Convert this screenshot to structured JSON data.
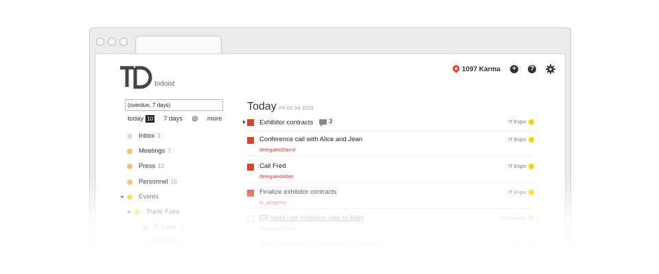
{
  "header": {
    "brand": "todoist",
    "karma": "1097 Karma",
    "add_icon": "+",
    "help_icon": "?"
  },
  "sidebar": {
    "filter_value": "(overdue, 7 days)",
    "quick": {
      "today": "today",
      "today_count": "10",
      "seven_days": "7 days",
      "at": "@",
      "more": "more"
    },
    "projects": [
      {
        "name": "Inbox",
        "count": "3",
        "color": "#dddddd"
      },
      {
        "name": "Meetings",
        "count": "7",
        "color": "#f5c36e"
      },
      {
        "name": "Press",
        "count": "12",
        "color": "#f5c36e"
      },
      {
        "name": "Personnel",
        "count": "10",
        "color": "#f5c36e"
      },
      {
        "name": "Events",
        "count": "",
        "color": "#f6d200"
      },
      {
        "name": "Trade Fairs",
        "count": "",
        "color": "#f6d200"
      },
      {
        "name": "IT Expo",
        "count": "10",
        "color": "#f6d200"
      },
      {
        "name": "CEBIT",
        "count": "14",
        "color": "#f6d200"
      }
    ]
  },
  "main": {
    "title": "Today",
    "date": "Fri 19 Jul 2013",
    "tasks": [
      {
        "title": "Exhibitor contracts",
        "sub": "",
        "project": "IT Expo",
        "comments": "3",
        "color": "#f6d200"
      },
      {
        "title": "Conference call with Alice and Jean",
        "sub": "delegatedDavid",
        "project": "IT Expo",
        "color": "#f6d200"
      },
      {
        "title": "Call Fred",
        "sub": "delegatedAllan",
        "project": "IT Expo",
        "color": "#f6d200"
      },
      {
        "title": "Finalize exhibitor contracts",
        "sub": "in_progress",
        "project": "IT Expo",
        "color": "#f6d200"
      },
      {
        "title": "Send new business plan to Mary",
        "sub": "delegatedDavid",
        "project": "Personnel",
        "color": "#f5c36e"
      },
      {
        "title": "Send final version of our flyer for journalists",
        "sub": "",
        "project": "Press",
        "color": "#f5c36e"
      }
    ]
  },
  "colors": {
    "accent": "#d9412b",
    "label_red": "#d93b3b",
    "label_pink": "#d9267a"
  }
}
